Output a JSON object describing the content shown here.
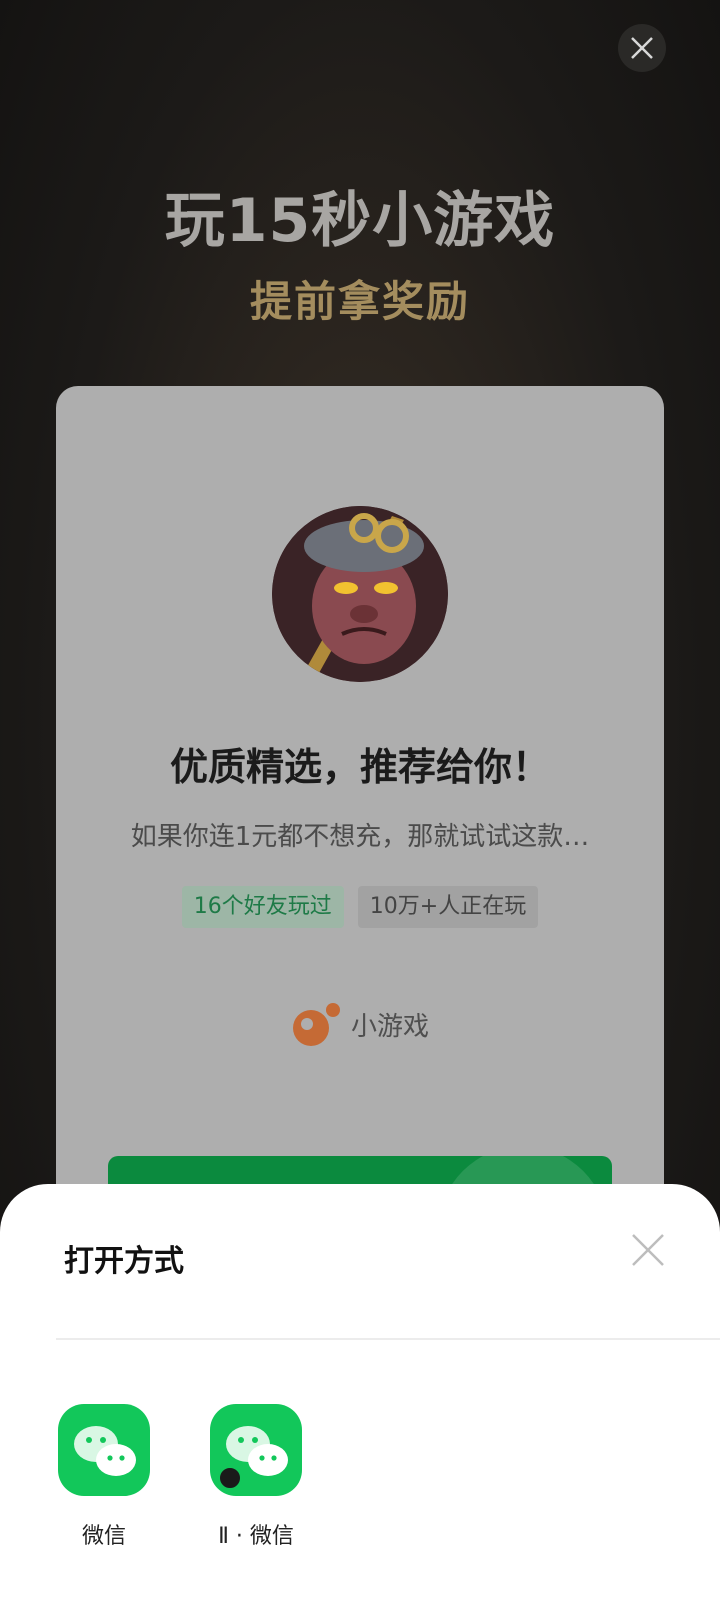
{
  "promo": {
    "headline": "玩15秒小游戏",
    "subheadline": "提前拿奖励"
  },
  "card": {
    "title": "优质精选，推荐给你！",
    "description": "如果你连1元都不想充，那就试试这款…",
    "tags": [
      "16个好友玩过",
      "10万+人正在玩"
    ],
    "brand_label": "小游戏"
  },
  "sheet": {
    "title": "打开方式",
    "apps": [
      {
        "label": "微信",
        "icon": "wechat-icon"
      },
      {
        "label": "Ⅱ · 微信",
        "icon": "wechat-clone-icon"
      }
    ]
  },
  "colors": {
    "accent_green": "#12c75a",
    "gold": "#a48d5e",
    "card_bg": "#aeaeae"
  }
}
